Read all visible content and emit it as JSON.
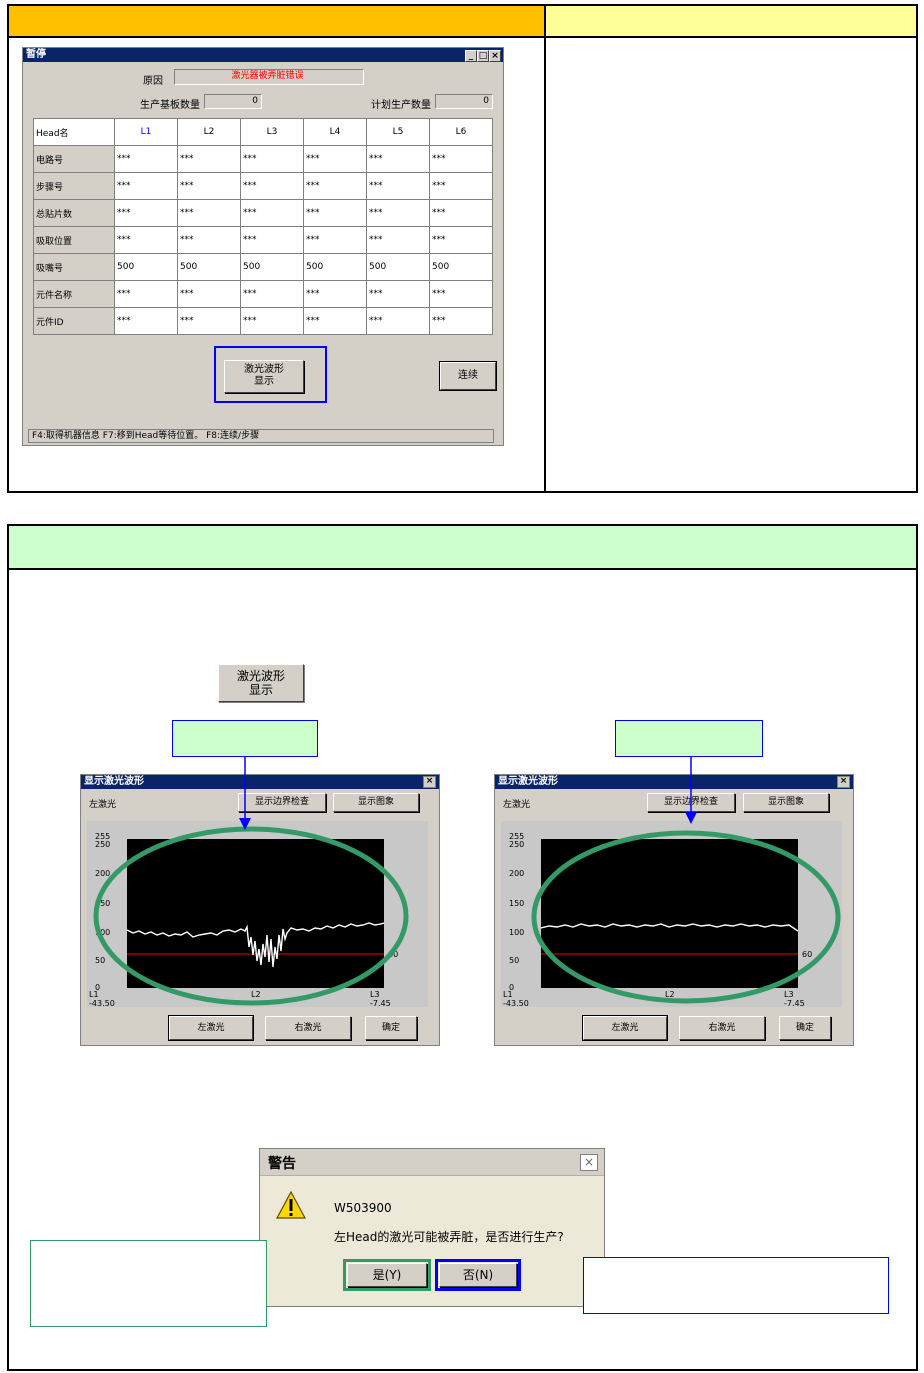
{
  "pause_window": {
    "title": "暂停",
    "reason_label": "原因",
    "reason_value": "激光器被弄脏错误",
    "boards_label": "生产基板数量",
    "boards_value": "0",
    "plan_label": "计划生产数量",
    "plan_value": "0",
    "table": {
      "columns": [
        "Head名",
        "L1",
        "L2",
        "L3",
        "L4",
        "L5",
        "L6"
      ],
      "rows": [
        {
          "label": "电路号",
          "cells": [
            "***",
            "***",
            "***",
            "***",
            "***",
            "***"
          ]
        },
        {
          "label": "步骤号",
          "cells": [
            "***",
            "***",
            "***",
            "***",
            "***",
            "***"
          ]
        },
        {
          "label": "总贴片数",
          "cells": [
            "***",
            "***",
            "***",
            "***",
            "***",
            "***"
          ]
        },
        {
          "label": "吸取位置",
          "cells": [
            "***",
            "***",
            "***",
            "***",
            "***",
            "***"
          ]
        },
        {
          "label": "吸嘴号",
          "cells": [
            "500",
            "500",
            "500",
            "500",
            "500",
            "500"
          ]
        },
        {
          "label": "元件名称",
          "cells": [
            "***",
            "***",
            "***",
            "***",
            "***",
            "***"
          ]
        },
        {
          "label": "元件ID",
          "cells": [
            "***",
            "***",
            "***",
            "***",
            "***",
            "***"
          ]
        }
      ]
    },
    "laser_button": [
      "激光波形",
      "显示"
    ],
    "continue_button": "连续",
    "status_bar": "F4:取得机器信息  F7:移到Head等待位置。  F8:连续/步骤"
  },
  "laser_button_sample": [
    "激光波形",
    "显示"
  ],
  "wave_left": {
    "title": "显示激光波形",
    "side_label": "左激光",
    "btn_bound": "显示边界检查",
    "btn_image": "显示图象",
    "btn_left": "左激光",
    "btn_right": "右激光",
    "btn_ok": "确定",
    "yticks": [
      "255",
      "250",
      "200",
      "150",
      "100",
      "50",
      "0"
    ],
    "threshold_label": "60",
    "x_labels": [
      [
        "L1",
        "-43.50"
      ],
      [
        "L2",
        ""
      ],
      [
        "L3",
        "-7.45"
      ]
    ]
  },
  "wave_right": {
    "title": "显示激光波形",
    "side_label": "左激光",
    "btn_bound": "显示边界检查",
    "btn_image": "显示图象",
    "btn_left": "左激光",
    "btn_right": "右激光",
    "btn_ok": "确定",
    "yticks": [
      "255",
      "250",
      "200",
      "150",
      "100",
      "50",
      "0"
    ],
    "threshold_label": "60",
    "x_labels": [
      [
        "L1",
        "-43.50"
      ],
      [
        "L2",
        ""
      ],
      [
        "L3",
        "-7.45"
      ]
    ]
  },
  "warning_dialog": {
    "title": "警告",
    "code": "W503900",
    "message": "左Head的激光可能被弄脏，是否进行生产?",
    "yes_button": "是(Y)",
    "no_button": "否(N)"
  },
  "colors": {
    "header_orange": "#ffc000",
    "header_yellow": "#ffff99",
    "header_green": "#ccffcc",
    "ellipse_green": "#339966",
    "highlight_blue": "#0000ff",
    "title_blue": "#0a246a",
    "error_red": "#ff0000"
  }
}
